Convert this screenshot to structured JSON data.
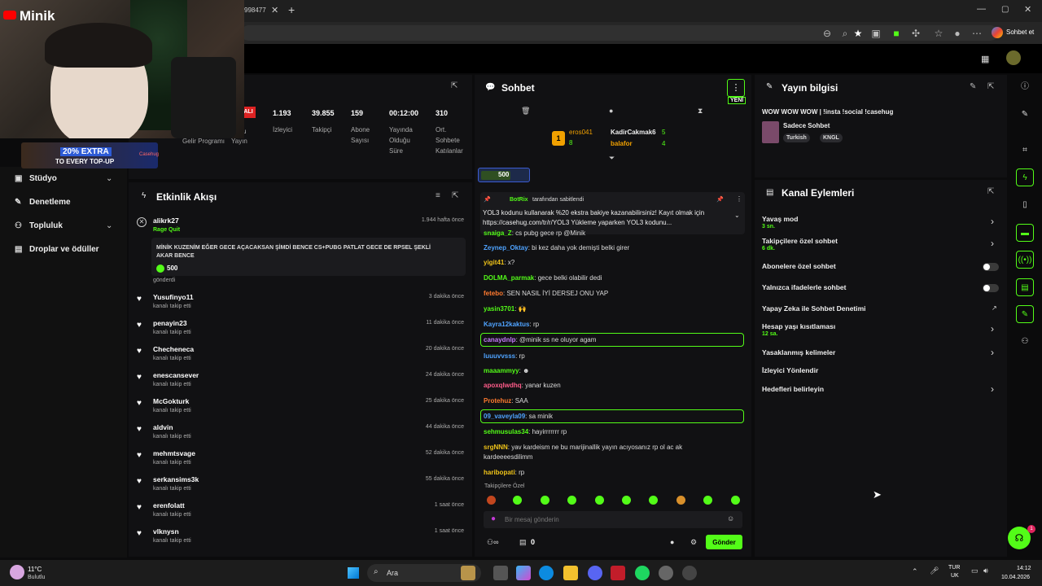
{
  "browser": {
    "tab_fragment": "998477",
    "chat_button": "Sohbet et"
  },
  "overlay": {
    "brand": "Minik",
    "promo_main": "20% EXTRA",
    "promo_sub": "TO EVERY TOP-UP",
    "promo_brand": "Casehug"
  },
  "nav": {
    "items": [
      {
        "label": "Stüdyo",
        "icon": "video-icon"
      },
      {
        "label": "Denetleme",
        "icon": "wrench-icon"
      },
      {
        "label": "Topluluk",
        "icon": "people-icon"
      },
      {
        "label": "Droplar ve ödüller",
        "icon": "gift-icon"
      }
    ]
  },
  "stats": {
    "live_badge": "ALI",
    "partial_labels": [
      "Gelir Programı",
      "u",
      "Yayın"
    ],
    "items": [
      {
        "value": "1.193",
        "label": "İzleyici"
      },
      {
        "value": "39.855",
        "label": "Takipçi"
      },
      {
        "value": "159",
        "label": "Abone Sayısı"
      },
      {
        "value": "00:12:00",
        "label": "Yayında Olduğu Süre"
      },
      {
        "value": "310",
        "label": "Ort. Sohbete Katılanlar"
      }
    ]
  },
  "activity": {
    "title": "Etkinlik Akışı",
    "gift": {
      "user": "alikrk27",
      "tag": "Rage Quit",
      "time": "1.944 hafta önce",
      "message": "MİNİK KUZENİM EĞER GECE AÇACAKSAN ŞİMDİ BENCE CS+PUBG PATLAT GECE DE RPSEL ŞEKLİ AKAR BENCE",
      "amount": "500",
      "suffix": "gönderdi"
    },
    "follow_text": "kanalı takip etti",
    "follows": [
      {
        "user": "Yusufinyo11",
        "time": "3 dakika önce"
      },
      {
        "user": "penayin23",
        "time": "11 dakika önce"
      },
      {
        "user": "Checheneca",
        "time": "20 dakika önce"
      },
      {
        "user": "enescansever",
        "time": "24 dakika önce"
      },
      {
        "user": "McGokturk",
        "time": "25 dakika önce"
      },
      {
        "user": "aldvin",
        "time": "44 dakika önce"
      },
      {
        "user": "mehmtsvage",
        "time": "52 dakika önce"
      },
      {
        "user": "serkansims3k",
        "time": "55 dakika önce"
      },
      {
        "user": "erenfolatt",
        "time": "1 saat önce"
      },
      {
        "user": "vlknysn",
        "time": "1 saat önce"
      }
    ]
  },
  "chat": {
    "title": "Sohbet",
    "new_badge": "YENİ",
    "rank_number": "1",
    "leaders": [
      {
        "name": "eros041",
        "count": "8"
      },
      {
        "name": "KadirCakmak6",
        "count": "5"
      },
      {
        "name": "balafor",
        "count": "4"
      }
    ],
    "kicks_amount": "500",
    "pinned_by": "BotRix",
    "pinned_label": "tarafından sabitlendi",
    "pinned_text": "YOL3 kodunu kullanarak %20 ekstra bakiye kazanabilirsiniz! Kayıt olmak için https://casehug.com/tr/r/YOL3 Yükleme yaparken YOL3 kodunu...",
    "messages": [
      {
        "user": "snaiga_Z",
        "text": "cs pubg gece rp @Minik",
        "color": "#53fc18"
      },
      {
        "user": "Zeynep_Oktay",
        "text": "bi kez daha yok demişti belki girer",
        "color": "#4fa3ff"
      },
      {
        "user": "yigit41",
        "text": "x?",
        "color": "#f0c419"
      },
      {
        "user": "DOLMA_parmak",
        "text": "gece belki olabilir dedi",
        "color": "#53fc18"
      },
      {
        "user": "fetebo",
        "text": "SEN NASIL İYİ DERSEJ ONU YAP",
        "color": "#ff7a2f"
      },
      {
        "user": "yasin3701",
        "text": "🙌",
        "color": "#53fc18"
      },
      {
        "user": "Kayra12kaktus",
        "text": "rp",
        "color": "#4fa3ff"
      },
      {
        "user": "canaydnlp",
        "text": "@minik ss ne oluyor agam",
        "color": "#c77dff"
      },
      {
        "user": "luuuvvsss",
        "text": "rp",
        "color": "#4fa3ff"
      },
      {
        "user": "maaammyy",
        "text": "",
        "color": "#53fc18"
      },
      {
        "user": "apoxqlwdhq",
        "text": "yanar kuzen",
        "color": "#ff5c8a"
      },
      {
        "user": "Protehuz",
        "text": "SAA",
        "color": "#ff7a2f"
      },
      {
        "user": "09_vaveyla09",
        "text": "sa minik",
        "color": "#4fa3ff"
      },
      {
        "user": "sehmusulas34",
        "text": "hayirrrrrrr rp",
        "color": "#53fc18"
      },
      {
        "user": "srgNNN",
        "text": "yav kardeism ne bu marijinallik yayın acıyosanız rp ol ac ak",
        "color": "#f0c419"
      },
      {
        "user": "",
        "text": "kardeeeesdilimm",
        "color": "#dddddd"
      },
      {
        "user": "haribopati",
        "text": "rp",
        "color": "#f0c419"
      }
    ],
    "followers_only": "Takipçilere Özel",
    "input_placeholder": "Bir mesaj gönderin",
    "points": "0",
    "send_label": "Gönder"
  },
  "stream_info": {
    "title": "Yayın bilgisi",
    "stream_title": "WOW WOW WOW | !insta !social !casehug",
    "category": "Sadece Sohbet",
    "tags": [
      "Turkish",
      "KNGL"
    ]
  },
  "channel_actions": {
    "title": "Kanal Eylemleri",
    "items": [
      {
        "label": "Yavaş mod",
        "sub": "3 sn.",
        "control": "chevron"
      },
      {
        "label": "Takipçilere özel sohbet",
        "sub": "6 dk.",
        "control": "chevron"
      },
      {
        "label": "Abonelere özel sohbet",
        "sub": "",
        "control": "toggle"
      },
      {
        "label": "Yalnızca ifadelerle sohbet",
        "sub": "",
        "control": "toggle"
      },
      {
        "label": "Yapay Zeka ile Sohbet Denetimi",
        "sub": "",
        "control": "external"
      },
      {
        "label": "Hesap yaşı kısıtlaması",
        "sub": "12 sa.",
        "control": "chevron"
      },
      {
        "label": "Yasaklanmış kelimeler",
        "sub": "",
        "control": "chevron"
      },
      {
        "label": "İzleyici Yönlendir",
        "sub": "",
        "control": "none"
      },
      {
        "label": "Hedefleri belirleyin",
        "sub": "",
        "control": "chevron"
      }
    ]
  },
  "help_badge": "1",
  "taskbar": {
    "temp": "11°C",
    "weather": "Bulutlu",
    "search": "Ara",
    "lang1": "TUR",
    "lang2": "UK",
    "time": "14:12",
    "date": "10.04.2026"
  },
  "colors": {
    "accent": "#53fc18",
    "panel": "#111113"
  }
}
